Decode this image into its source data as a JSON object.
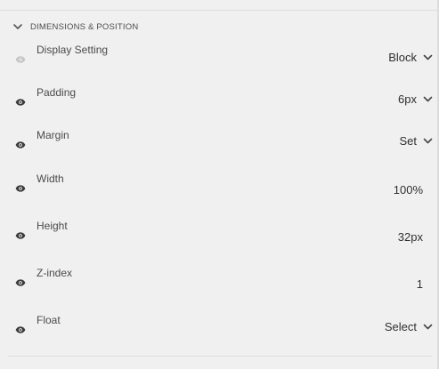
{
  "section": {
    "title": "DIMENSIONS & POSITION"
  },
  "properties": [
    {
      "label": "Display Setting",
      "value": "Block",
      "control": "dropdown",
      "visible": false
    },
    {
      "label": "Padding",
      "value": "6px",
      "control": "dropdown",
      "visible": true
    },
    {
      "label": "Margin",
      "value": "Set",
      "control": "dropdown",
      "visible": true
    },
    {
      "label": "Width",
      "value": "100%",
      "control": "input",
      "visible": true
    },
    {
      "label": "Height",
      "value": "32px",
      "control": "input",
      "visible": true
    },
    {
      "label": "Z-index",
      "value": "1",
      "control": "input",
      "visible": true
    },
    {
      "label": "Float",
      "value": "Select",
      "control": "dropdown",
      "visible": true
    }
  ],
  "colors": {
    "background": "#f0f0f0",
    "eye_active": "#3a3a3a",
    "eye_inactive": "#c4c4c4",
    "text": "#4b4b4b",
    "value_text": "#2f2f2f"
  }
}
